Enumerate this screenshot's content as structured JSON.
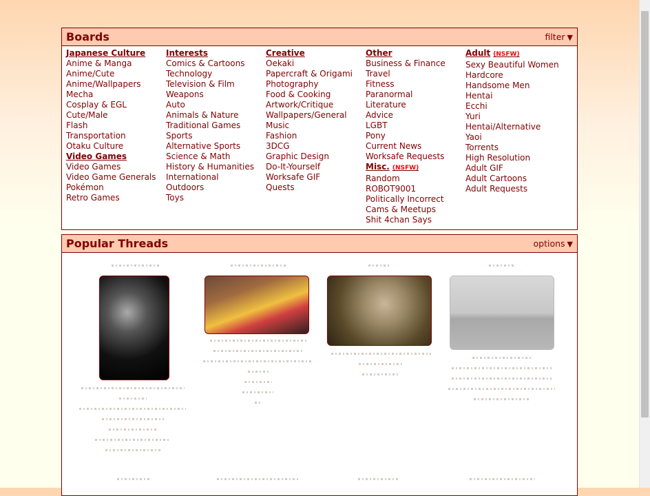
{
  "boards": {
    "title": "Boards",
    "filter_label": "filter",
    "columns": [
      {
        "groups": [
          {
            "heading": "Japanese Culture",
            "nsfw": "",
            "items": [
              "Anime & Manga",
              "Anime/Cute",
              "Anime/Wallpapers",
              "Mecha",
              "Cosplay & EGL",
              "Cute/Male",
              "Flash",
              "Transportation",
              "Otaku Culture"
            ]
          },
          {
            "heading": "Video Games",
            "nsfw": "",
            "items": [
              "Video Games",
              "Video Game Generals",
              "Pokémon",
              "Retro Games"
            ]
          }
        ]
      },
      {
        "groups": [
          {
            "heading": "Interests",
            "nsfw": "",
            "items": [
              "Comics & Cartoons",
              "Technology",
              "Television & Film",
              "Weapons",
              "Auto",
              "Animals & Nature",
              "Traditional Games",
              "Sports",
              "Alternative Sports",
              "Science & Math",
              "History & Humanities",
              "International",
              "Outdoors",
              "Toys"
            ]
          }
        ]
      },
      {
        "groups": [
          {
            "heading": "Creative",
            "nsfw": "",
            "items": [
              "Oekaki",
              "Papercraft & Origami",
              "Photography",
              "Food & Cooking",
              "Artwork/Critique",
              "Wallpapers/General",
              "Music",
              "Fashion",
              "3DCG",
              "Graphic Design",
              "Do-It-Yourself",
              "Worksafe GIF",
              "Quests"
            ]
          }
        ]
      },
      {
        "groups": [
          {
            "heading": "Other",
            "nsfw": "",
            "items": [
              "Business & Finance",
              "Travel",
              "Fitness",
              "Paranormal",
              "Literature",
              "Advice",
              "LGBT",
              "Pony",
              "Current News",
              "Worksafe Requests"
            ]
          },
          {
            "heading": "Misc.",
            "nsfw": "(NSFW)",
            "items": [
              "Random",
              "ROBOT9001",
              "Politically Incorrect",
              "Cams & Meetups",
              "Shit 4chan Says"
            ]
          }
        ]
      },
      {
        "groups": [
          {
            "heading": "Adult",
            "nsfw": "(NSFW)",
            "items": [
              "Sexy Beautiful Women",
              "Hardcore",
              "Handsome Men",
              "Hentai",
              "Ecchi",
              "Yuri",
              "Hentai/Alternative",
              "Yaoi",
              "Torrents",
              "High Resolution",
              "Adult GIF",
              "Adult Cartoons",
              "Adult Requests"
            ]
          }
        ]
      }
    ]
  },
  "threads": {
    "title": "Popular Threads",
    "options_label": "options"
  },
  "colors": {
    "accent": "#800000",
    "bar": "#fecab0",
    "nsfw": "#ff0000"
  }
}
